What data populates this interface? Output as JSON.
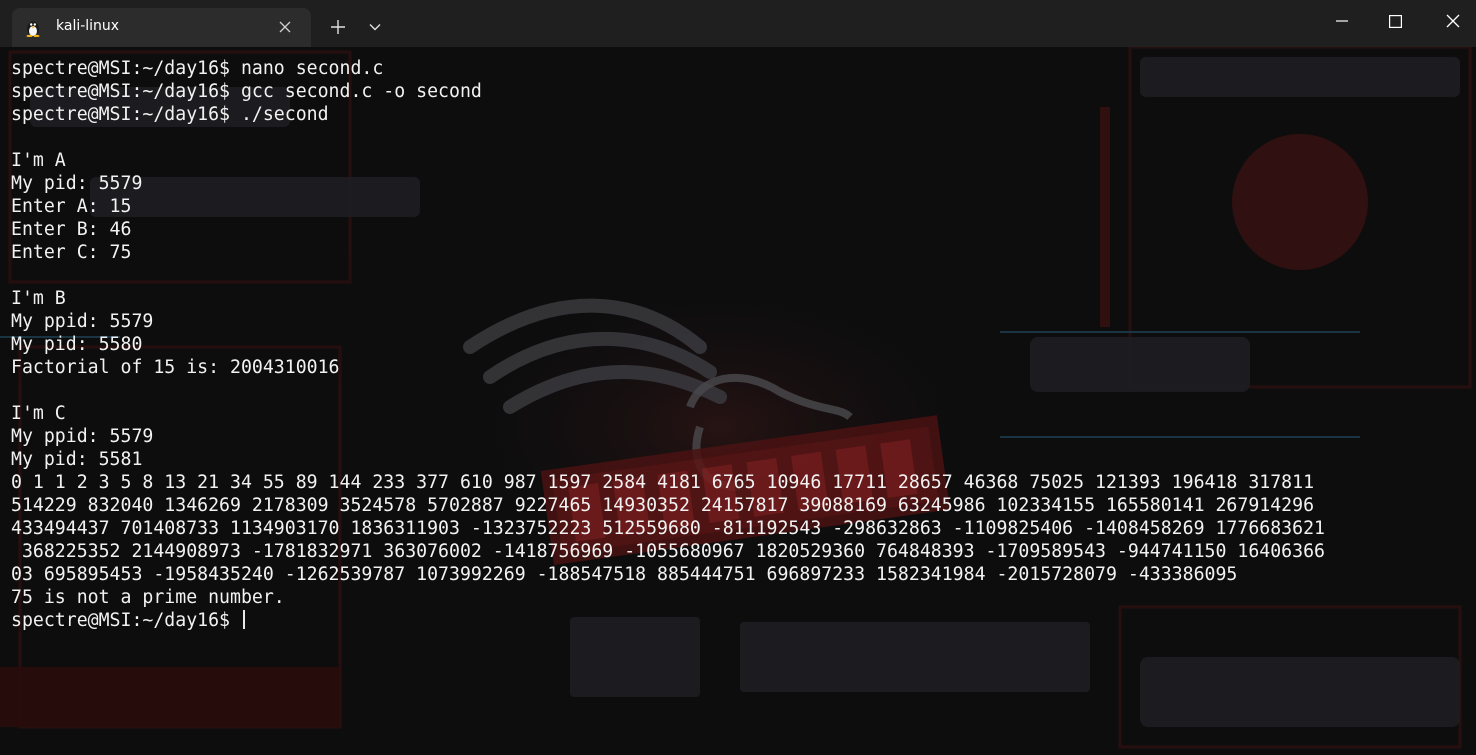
{
  "window": {
    "tab_title": "kali-linux",
    "icons": {
      "tab": "tux-penguin-icon",
      "tab_close": "close-icon",
      "new_tab": "plus-icon",
      "dropdown": "chevron-down-icon",
      "minimize": "minimize-icon",
      "maximize": "maximize-icon",
      "close": "close-icon"
    }
  },
  "colors": {
    "titlebar": "#1f1f1f",
    "tab": "#2c2c2c",
    "terminal_bg": "#0d0d0e",
    "terminal_text": "#f2f2f2",
    "logo_red": "#7a1d1d"
  },
  "terminal": {
    "lines": [
      "spectre@MSI:~/day16$ nano second.c",
      "spectre@MSI:~/day16$ gcc second.c -o second",
      "spectre@MSI:~/day16$ ./second",
      "",
      "I'm A",
      "My pid: 5579",
      "Enter A: 15",
      "Enter B: 46",
      "Enter C: 75",
      "",
      "I'm B",
      "My ppid: 5579",
      "My pid: 5580",
      "Factorial of 15 is: 2004310016",
      "",
      "I'm C",
      "My ppid: 5579",
      "My pid: 5581",
      "0 1 1 2 3 5 8 13 21 34 55 89 144 233 377 610 987 1597 2584 4181 6765 10946 17711 28657 46368 75025 121393 196418 317811",
      "514229 832040 1346269 2178309 3524578 5702887 9227465 14930352 24157817 39088169 63245986 102334155 165580141 267914296",
      "433494437 701408733 1134903170 1836311903 -1323752223 512559680 -811192543 -298632863 -1109825406 -1408458269 1776683621",
      " 368225352 2144908973 -1781832971 363076002 -1418756969 -1055680967 1820529360 764848393 -1709589543 -944741150 16406366",
      "03 695895453 -1958435240 -1262539787 1073992269 -188547518 885444751 696897233 1582341984 -2015728079 -433386095",
      "75 is not a prime number."
    ],
    "prompt": "spectre@MSI:~/day16$ "
  }
}
